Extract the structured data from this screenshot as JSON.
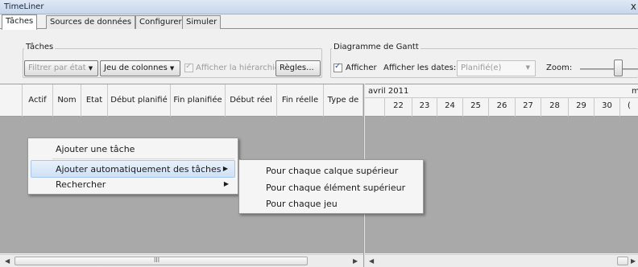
{
  "window": {
    "title": "TimeLiner",
    "close_glyph": "x"
  },
  "tabs": [
    {
      "label": "Tâches",
      "active": true
    },
    {
      "label": "Sources de données",
      "active": false
    },
    {
      "label": "Configurer",
      "active": false
    },
    {
      "label": "Simuler",
      "active": false
    }
  ],
  "tasks_group": {
    "legend": "Tâches",
    "filter_label": "Filtrer par état",
    "columns_button": "Jeu de colonnes",
    "show_hierarchy_label": "Afficher la hiérarchie",
    "rules_button": "Règles..."
  },
  "gantt_group": {
    "legend": "Diagramme de Gantt",
    "show_label": "Afficher",
    "show_dates_label": "Afficher les dates:",
    "dates_value": "Planifié(e)",
    "zoom_label": "Zoom:"
  },
  "table": {
    "columns": [
      "Actif",
      "Nom",
      "Etat",
      "Début planifié",
      "Fin planifiée",
      "Début réel",
      "Fin réelle",
      "Type de"
    ]
  },
  "gantt": {
    "month": "avril 2011",
    "next_month_partial": "m",
    "days": [
      "22",
      "23",
      "24",
      "25",
      "26",
      "27",
      "28",
      "29",
      "30",
      "("
    ]
  },
  "context_menu": {
    "items": [
      {
        "label": "Ajouter une tâche"
      },
      {
        "label": "Ajouter automatiquement des tâches",
        "submenu": true
      },
      {
        "label": "Rechercher",
        "submenu": true
      }
    ]
  },
  "submenu": {
    "items": [
      {
        "label": "Pour chaque calque supérieur"
      },
      {
        "label": "Pour chaque élément supérieur"
      },
      {
        "label": "Pour chaque jeu"
      }
    ]
  },
  "scrollbar": {
    "grip_glyph": "III"
  },
  "colors": {
    "grid_body": "#a9a9a9",
    "menu_highlight": "#cfe1f6",
    "title_bar": "#c7d7ec"
  }
}
